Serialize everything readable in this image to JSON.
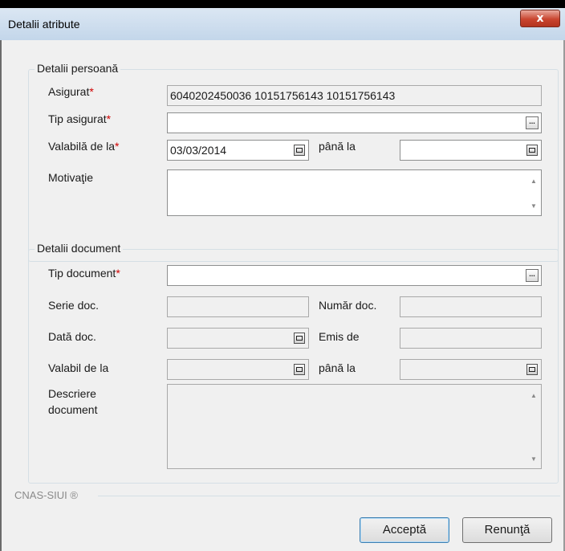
{
  "window": {
    "title": "Detalii atribute",
    "close": "x"
  },
  "persona": {
    "legend": "Detalii persoană",
    "asigurat_label": "Asigurat",
    "asigurat_value": "6040202450036 10151756143 10151756143",
    "tip_asigurat_label": "Tip asigurat",
    "tip_asigurat_value": "",
    "valabila_label": "Valabilă de la",
    "valabila_value": "03/03/2014",
    "pana_label": "până la",
    "pana_value": "",
    "motivatie_label": "Motivaţie",
    "motivatie_value": ""
  },
  "document": {
    "legend": "Detalii document",
    "tip_label": "Tip document",
    "tip_value": "",
    "serie_label": "Serie doc.",
    "serie_value": "",
    "numar_label": "Număr doc.",
    "numar_value": "",
    "data_label": "Dată doc.",
    "data_value": "",
    "emis_label": "Emis de",
    "emis_value": "",
    "valabil_label": "Valabil de la",
    "valabil_value": "",
    "pana_label": "până la",
    "pana_value": "",
    "descriere_label_1": "Descriere",
    "descriere_label_2": "document",
    "descriere_value": ""
  },
  "required_mark": "*",
  "footer": {
    "brand": "CNAS-SIUI ®",
    "accept": "Acceptă",
    "cancel": "Renunţă"
  },
  "icons": {
    "ellipsis": "...",
    "scroll_up": "▲",
    "scroll_down": "▼"
  },
  "colors": {
    "required": "#d00000",
    "close_button": "#c9452f"
  }
}
